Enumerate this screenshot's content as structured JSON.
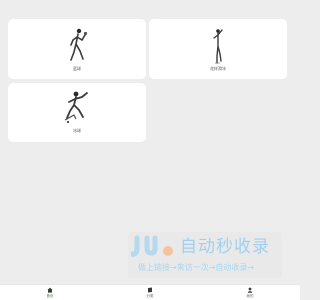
{
  "cards": [
    {
      "label": "篮球",
      "icon": "basketball-player-sketch"
    },
    {
      "label": "花样滑冰",
      "icon": "figure-skater-sketch"
    },
    {
      "label": "冰球",
      "icon": "hockey-player-sketch"
    }
  ],
  "watermark": {
    "brand": "自动秒收录",
    "tagline": "做上链接→来访一次→自动收录→"
  },
  "tabbar": {
    "items": [
      {
        "label": "首页",
        "icon": "home-icon",
        "active": true
      },
      {
        "label": "分类",
        "icon": "category-icon",
        "active": false
      },
      {
        "label": "我的",
        "icon": "user-icon",
        "active": false
      }
    ]
  },
  "colors": {
    "background": "#ededed",
    "card": "#ffffff",
    "accent": "#3a8b34",
    "watermark_text": "#9fd1ef"
  }
}
